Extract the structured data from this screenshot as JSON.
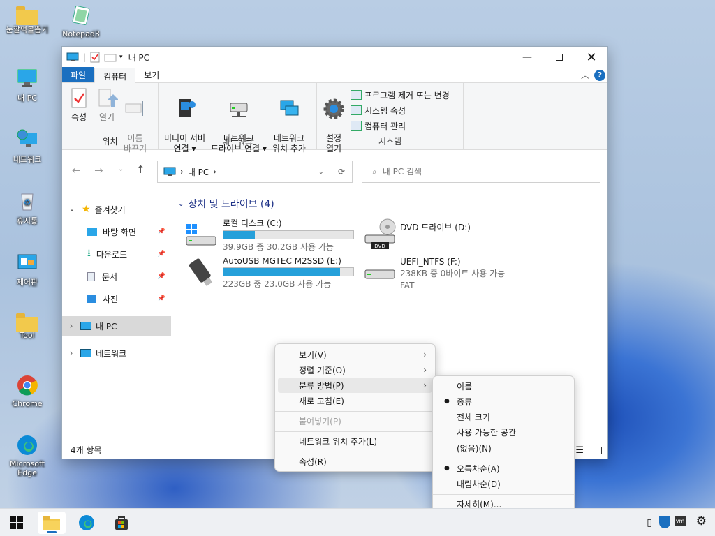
{
  "desktop": {
    "icons": [
      "눈깔먹몰뽑기",
      "Notepad3",
      "내 PC",
      "네트워크",
      "휴지통",
      "제어판",
      "Tool",
      "Chrome",
      "Microsoft\nEdge"
    ]
  },
  "window": {
    "title": "내 PC",
    "tabs": [
      "파일",
      "컴퓨터",
      "보기"
    ],
    "ribbon": {
      "location": {
        "label": "위치",
        "buttons": [
          "속성",
          "열기",
          "이름\n바꾸기"
        ]
      },
      "network": {
        "label": "네트워크",
        "buttons": [
          "미디어 서버\n연결 ▾",
          "네트워크\n드라이브 연결 ▾",
          "네트워크\n위치 추가"
        ]
      },
      "system": {
        "label": "시스템",
        "settings": "설정\n열기",
        "items": [
          "프로그램 제거 또는 변경",
          "시스템 속성",
          "컴퓨터 관리"
        ]
      }
    },
    "breadcrumb": [
      "내 PC"
    ],
    "search_placeholder": "내 PC 검색",
    "nav": {
      "favorites": "즐겨찾기",
      "quick": [
        "바탕 화면",
        "다운로드",
        "문서",
        "사진"
      ],
      "thispc": "내 PC",
      "network": "네트워크"
    },
    "section": "장치 및 드라이브 (4)",
    "drives": [
      {
        "name": "로컬 디스크 (C:)",
        "info": "39.9GB 중 30.2GB 사용 가능",
        "used": 0.24
      },
      {
        "name": "DVD 드라이브 (D:)",
        "info": ""
      },
      {
        "name": "AutoUSB MGTEC M2SSD (E:)",
        "info": "223GB 중 23.0GB 사용 가능",
        "used": 0.9
      },
      {
        "name": "UEFI_NTFS (F:)",
        "info": "238KB 중 0바이트 사용 가능",
        "fs": "FAT"
      }
    ],
    "status": "4개 항목"
  },
  "context_menu": {
    "items": [
      "보기(V)",
      "정렬 기준(O)",
      "분류 방법(P)",
      "새로 고침(E)",
      "붙여넣기(P)",
      "네트워크 위치 추가(L)",
      "속성(R)"
    ]
  },
  "submenu": {
    "items": [
      "이름",
      "종류",
      "전체 크기",
      "사용 가능한 공간",
      "(없음)(N)",
      "오름차순(A)",
      "내림차순(D)",
      "자세히(M)..."
    ]
  },
  "colors": {
    "accent": "#1a6fc0",
    "bar": "#26a0da"
  }
}
